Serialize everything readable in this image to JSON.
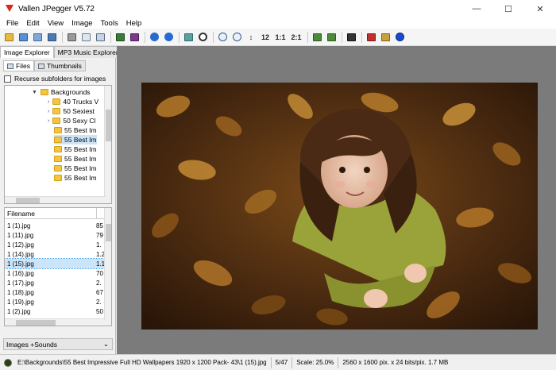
{
  "window": {
    "title": "Vallen JPegger V5.72",
    "minimize": "—",
    "maximize": "☐",
    "close": "✕"
  },
  "menu": [
    "File",
    "Edit",
    "View",
    "Image",
    "Tools",
    "Help"
  ],
  "toolbar": {
    "zoom_1_2": "1:2",
    "zoom_1_1": "1:1",
    "zoom_2_1": "2:1",
    "zoom_12": "12"
  },
  "left_panel": {
    "tabs": [
      "Image Explorer",
      "MP3 Music Explorer"
    ],
    "subtabs": [
      "Files",
      "Thumbnails"
    ],
    "recurse_label": "Recurse subfolders for images",
    "tree": [
      {
        "label": "Backgrounds",
        "indent": 0,
        "expanded": true
      },
      {
        "label": "40 Trucks V",
        "indent": 1
      },
      {
        "label": "50 Sexiest",
        "indent": 1
      },
      {
        "label": "50 Sexy Cl",
        "indent": 1
      },
      {
        "label": "55 Best Im",
        "indent": 1
      },
      {
        "label": "55 Best Im",
        "indent": 1,
        "selected": true
      },
      {
        "label": "55 Best Im",
        "indent": 1
      },
      {
        "label": "55 Best Im",
        "indent": 1
      },
      {
        "label": "55 Best Im",
        "indent": 1
      },
      {
        "label": "55 Best Im",
        "indent": 1
      }
    ],
    "files_header": "Filename",
    "files": [
      {
        "name": "1 (1).jpg",
        "size": "85"
      },
      {
        "name": "1 (11).jpg",
        "size": "79"
      },
      {
        "name": "1 (12).jpg",
        "size": "1."
      },
      {
        "name": "1 (14).jpg",
        "size": "1.2"
      },
      {
        "name": "1 (15).jpg",
        "size": "1.1",
        "selected": true
      },
      {
        "name": "1 (16).jpg",
        "size": "70"
      },
      {
        "name": "1 (17).jpg",
        "size": "2."
      },
      {
        "name": "1 (18).jpg",
        "size": "67"
      },
      {
        "name": "1 (19).jpg",
        "size": "2."
      },
      {
        "name": "1 (2).jpg",
        "size": "50"
      }
    ],
    "bottom_select": "Images +Sounds"
  },
  "status": {
    "path": "E:\\Backgrounds\\55 Best Impressive Full HD Wallpapers 1920 x 1200 Pack- 43\\1 (15).jpg",
    "index": "5/47",
    "scale": "Scale: 25.0%",
    "info": "2560 x 1600 pix. x 24 bits/pix. 1.7 MB"
  },
  "colors": {
    "leaf_dark": "#3a2410",
    "leaf_mid": "#7a4a18",
    "leaf_light": "#b57a2a",
    "sweater": "#9aa23a",
    "hair": "#4a2a14"
  }
}
